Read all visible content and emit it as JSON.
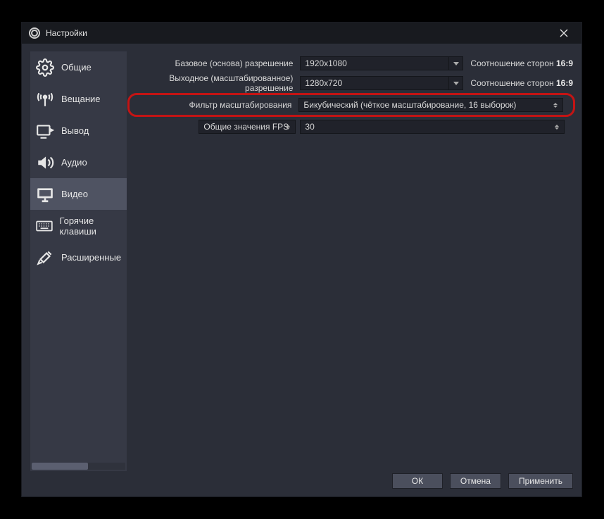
{
  "title": "Настройки",
  "sidebar": {
    "items": [
      {
        "label": "Общие",
        "icon": "gear"
      },
      {
        "label": "Вещание",
        "icon": "antenna"
      },
      {
        "label": "Вывод",
        "icon": "output"
      },
      {
        "label": "Аудио",
        "icon": "speaker"
      },
      {
        "label": "Видео",
        "icon": "monitor",
        "selected": true
      },
      {
        "label": "Горячие клавиши",
        "icon": "keyboard"
      },
      {
        "label": "Расширенные",
        "icon": "tools"
      }
    ]
  },
  "video": {
    "base": {
      "label": "Базовое (основа) разрешение",
      "value": "1920x1080",
      "aspect_label": "Соотношение сторон",
      "aspect_value": "16:9"
    },
    "output": {
      "label": "Выходное (масштабированное) разрешение",
      "value": "1280x720",
      "aspect_label": "Соотношение сторон",
      "aspect_value": "16:9"
    },
    "filter": {
      "label": "Фильтр масштабирования",
      "value": "Бикубический (чёткое масштабирование, 16 выборок)"
    },
    "fps": {
      "label": "Общие значения FPS",
      "value": "30"
    }
  },
  "buttons": {
    "ok": "ОК",
    "cancel": "Отмена",
    "apply": "Применить"
  }
}
